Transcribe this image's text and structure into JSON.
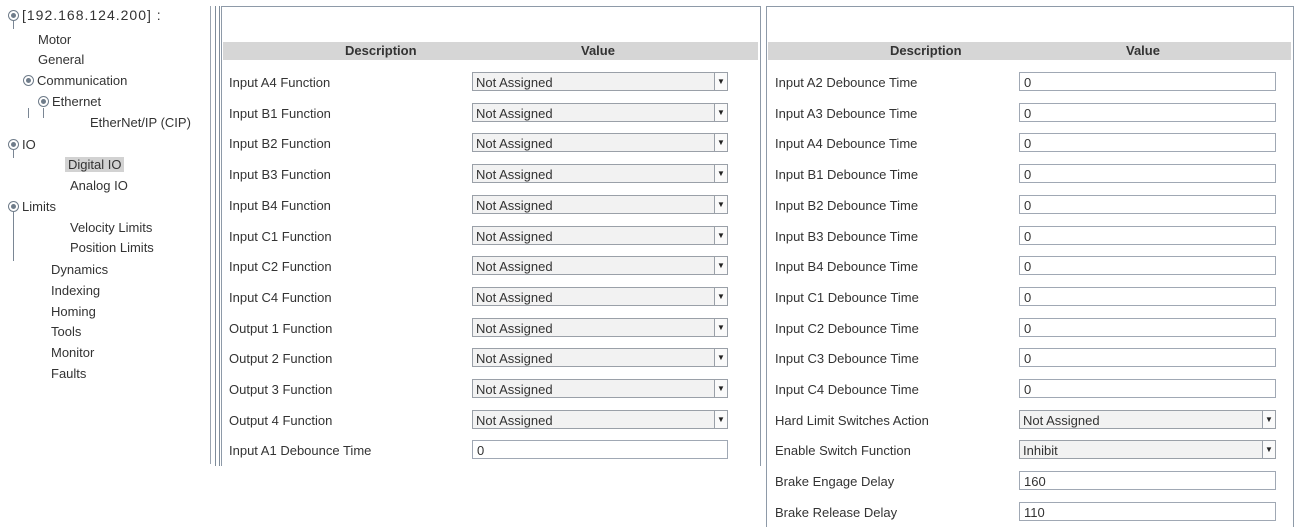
{
  "tree": {
    "root": "[192.168.124.200] :",
    "items": [
      {
        "label": "Motor"
      },
      {
        "label": "General"
      },
      {
        "label": "Communication"
      },
      {
        "label": "Ethernet"
      },
      {
        "label": "EtherNet/IP (CIP)"
      },
      {
        "label": "IO"
      },
      {
        "label": "Digital IO",
        "selected": true
      },
      {
        "label": "Analog IO"
      },
      {
        "label": "Limits"
      },
      {
        "label": "Velocity Limits"
      },
      {
        "label": "Position Limits"
      },
      {
        "label": "Dynamics"
      },
      {
        "label": "Indexing"
      },
      {
        "label": "Homing"
      },
      {
        "label": "Tools"
      },
      {
        "label": "Monitor"
      },
      {
        "label": "Faults"
      }
    ]
  },
  "table_left": {
    "headers": {
      "description": "Description",
      "value": "Value"
    },
    "rows": [
      {
        "description": "Input A4 Function",
        "value": "Not Assigned",
        "kind": "select"
      },
      {
        "description": "Input B1 Function",
        "value": "Not Assigned",
        "kind": "select"
      },
      {
        "description": "Input B2 Function",
        "value": "Not Assigned",
        "kind": "select"
      },
      {
        "description": "Input B3 Function",
        "value": "Not Assigned",
        "kind": "select"
      },
      {
        "description": "Input B4 Function",
        "value": "Not Assigned",
        "kind": "select"
      },
      {
        "description": "Input C1 Function",
        "value": "Not Assigned",
        "kind": "select"
      },
      {
        "description": "Input C2 Function",
        "value": "Not Assigned",
        "kind": "select"
      },
      {
        "description": "Input C4 Function",
        "value": "Not Assigned",
        "kind": "select"
      },
      {
        "description": "Output 1 Function",
        "value": "Not Assigned",
        "kind": "select"
      },
      {
        "description": "Output 2 Function",
        "value": "Not Assigned",
        "kind": "select"
      },
      {
        "description": "Output 3 Function",
        "value": "Not Assigned",
        "kind": "select"
      },
      {
        "description": "Output 4 Function",
        "value": "Not Assigned",
        "kind": "select"
      },
      {
        "description": "Input A1 Debounce Time",
        "value": "0",
        "kind": "text"
      }
    ]
  },
  "table_right": {
    "headers": {
      "description": "Description",
      "value": "Value"
    },
    "rows": [
      {
        "description": "Input A2 Debounce Time",
        "value": "0",
        "kind": "text"
      },
      {
        "description": "Input A3 Debounce Time",
        "value": "0",
        "kind": "text"
      },
      {
        "description": "Input A4 Debounce Time",
        "value": "0",
        "kind": "text"
      },
      {
        "description": "Input B1 Debounce Time",
        "value": "0",
        "kind": "text"
      },
      {
        "description": "Input B2 Debounce Time",
        "value": "0",
        "kind": "text"
      },
      {
        "description": "Input B3 Debounce Time",
        "value": "0",
        "kind": "text"
      },
      {
        "description": "Input B4 Debounce Time",
        "value": "0",
        "kind": "text"
      },
      {
        "description": "Input C1 Debounce Time",
        "value": "0",
        "kind": "text"
      },
      {
        "description": "Input C2 Debounce Time",
        "value": "0",
        "kind": "text"
      },
      {
        "description": "Input C3 Debounce Time",
        "value": "0",
        "kind": "text"
      },
      {
        "description": "Input C4 Debounce Time",
        "value": "0",
        "kind": "text"
      },
      {
        "description": "Hard Limit Switches Action",
        "value": "Not Assigned",
        "kind": "select"
      },
      {
        "description": "Enable Switch Function",
        "value": "Inhibit",
        "kind": "select"
      },
      {
        "description": "Brake Engage Delay",
        "value": "160",
        "kind": "text"
      },
      {
        "description": "Brake Release Delay",
        "value": "110",
        "kind": "text"
      }
    ]
  },
  "icons": {
    "expander": "expander-icon",
    "dropdown": "dropdown-arrow-icon"
  }
}
